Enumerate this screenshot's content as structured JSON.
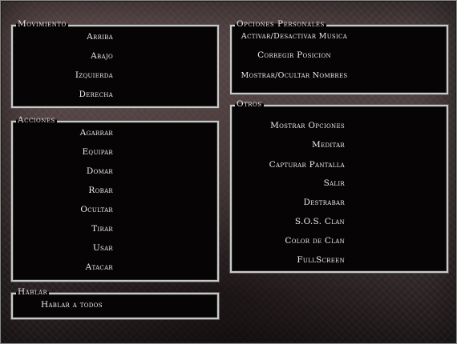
{
  "movimiento": {
    "title": "Movimiento",
    "items": [
      "Arriba",
      "Abajo",
      "Izquierda",
      "Derecha"
    ]
  },
  "acciones": {
    "title": "Acciones",
    "items": [
      "Agarrar",
      "Equipar",
      "Domar",
      "Robar",
      "Ocultar",
      "Tirar",
      "Usar",
      "Atacar"
    ]
  },
  "hablar": {
    "title": "Hablar",
    "items": [
      "Hablar a todos"
    ]
  },
  "opciones_personales": {
    "title": "Opciones Personales",
    "items": [
      "Activar/Desactivar Musica",
      "Corregir Posicion",
      "Mostrar/Ocultar Nombres"
    ]
  },
  "otros": {
    "title": "Otros",
    "items": [
      "Mostrar Opciones",
      "Meditar",
      "Capturar Pantalla",
      "Salir",
      "Destrabar",
      "S.O.S. Clan",
      "Color de Clan",
      "FullScreen"
    ]
  }
}
